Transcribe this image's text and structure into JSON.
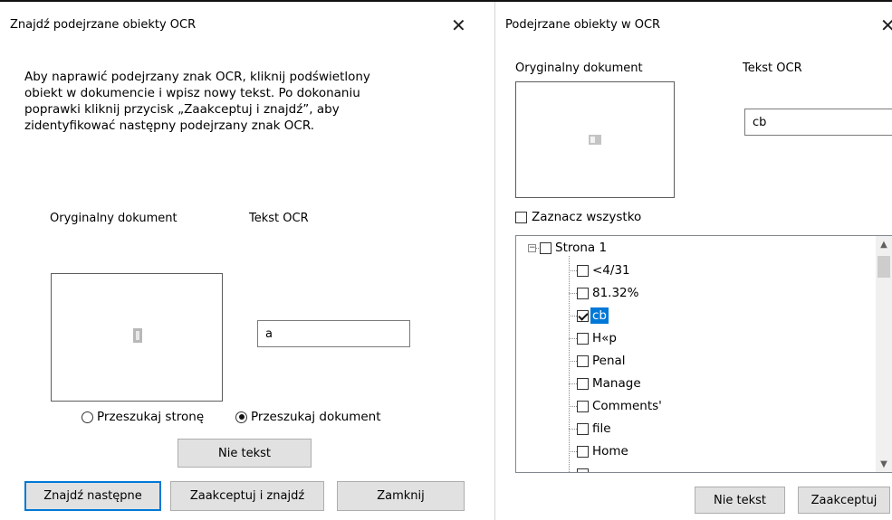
{
  "dialog1": {
    "title": "Znajdź podejrzane obiekty OCR",
    "close_glyph": "✕",
    "instructions": "Aby naprawić podejrzany znak OCR, kliknij podświetlony\nobiekt w dokumencie i wpisz nowy tekst. Po dokonaniu\npoprawki kliknij przycisk „Zaakceptuj i znajdź”, aby\nzidentyfikować następny podejrzany znak OCR.",
    "original_label": "Oryginalny dokument",
    "ocr_label": "Tekst OCR",
    "ocr_value": "a",
    "radio_page": "Przeszukaj stronę",
    "radio_document": "Przeszukaj dokument",
    "selected_radio": "document",
    "not_text_button": "Nie tekst",
    "find_next_button": "Znajdź następne",
    "accept_find_button": "Zaakceptuj i znajdź",
    "close_button": "Zamknij"
  },
  "dialog2": {
    "title": "Podejrzane obiekty w OCR",
    "close_glyph": "✕",
    "original_label": "Oryginalny dokument",
    "ocr_label": "Tekst OCR",
    "ocr_value": "cb",
    "select_all_label": "Zaznacz wszystko",
    "tree": {
      "root_label": "Strona 1",
      "items": [
        {
          "label": "<4/31",
          "checked": false
        },
        {
          "label": "81.32%",
          "checked": false
        },
        {
          "label": "cb",
          "checked": true
        },
        {
          "label": "H«p",
          "checked": false
        },
        {
          "label": "Penal",
          "checked": false
        },
        {
          "label": "Manage",
          "checked": false
        },
        {
          "label": "Comments'",
          "checked": false
        },
        {
          "label": "file",
          "checked": false
        },
        {
          "label": "Home",
          "checked": false
        }
      ]
    },
    "not_text_button": "Nie tekst",
    "accept_button": "Zaakceptuj"
  }
}
